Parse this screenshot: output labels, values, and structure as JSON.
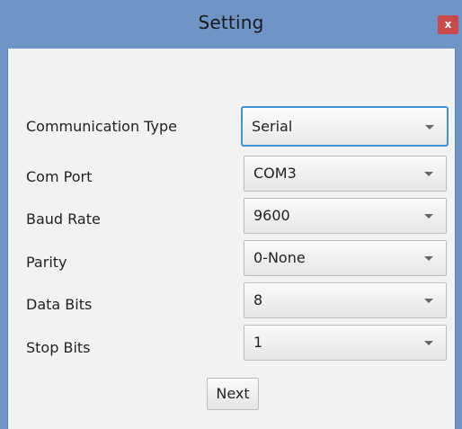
{
  "window": {
    "title": "Setting",
    "close_label": "x"
  },
  "form": {
    "fields": [
      {
        "label": "Communication Type",
        "value": "Serial"
      },
      {
        "label": "Com Port",
        "value": "COM3"
      },
      {
        "label": "Baud Rate",
        "value": "9600"
      },
      {
        "label": "Parity",
        "value": "0-None"
      },
      {
        "label": "Data Bits",
        "value": "8"
      },
      {
        "label": "Stop Bits",
        "value": "1"
      }
    ],
    "next_label": "Next"
  },
  "colors": {
    "titlebar": "#6f95c6",
    "close_button": "#c94a4a",
    "focus_border": "#3c93d6",
    "client_background": "#f2f2f2"
  }
}
